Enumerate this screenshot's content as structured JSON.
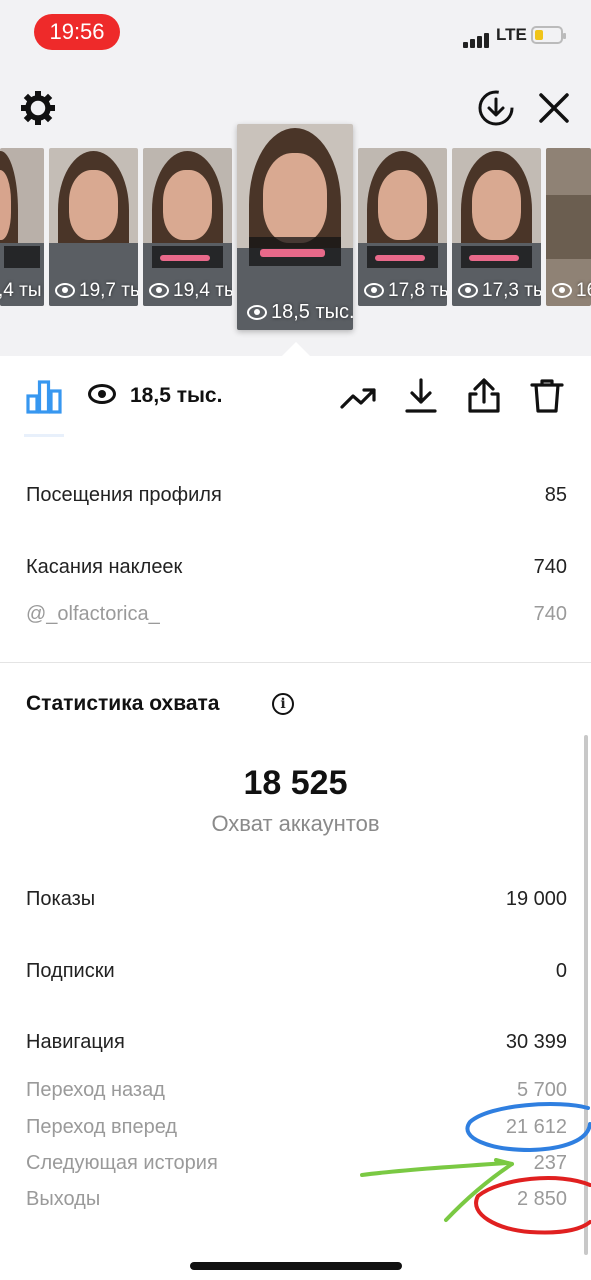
{
  "status_bar": {
    "time": "19:56",
    "network": "LTE",
    "time_pill_color": "#ee2a2a",
    "battery_color": "#f0c419"
  },
  "header_icons": [
    "gear-icon",
    "download-circle-icon",
    "close-icon"
  ],
  "thumbnails": [
    {
      "views": ",4 ты"
    },
    {
      "views": "19,7 ты"
    },
    {
      "views": "19,4 ты"
    },
    {
      "views": "18,5 тыс.",
      "selected": true
    },
    {
      "views": "17,8 ты"
    },
    {
      "views": "17,3 ты"
    },
    {
      "views": "16"
    }
  ],
  "toolbar": {
    "views": "18,5 тыс.",
    "icons": [
      "bar-chart-icon",
      "eye-icon",
      "trending-icon",
      "download-icon",
      "share-icon",
      "trash-icon"
    ],
    "accent": "#3797f0"
  },
  "interactions": {
    "profile_visits": {
      "label": "Посещения профиля",
      "value": "85"
    },
    "sticker_taps": {
      "label": "Касания наклеек",
      "value": "740"
    },
    "sticker_mention": {
      "label": "@_olfactorica_",
      "value": "740"
    }
  },
  "reach": {
    "title": "Статистика охвата",
    "accounts_reached": "18 525",
    "accounts_reached_label": "Охват аккаунтов",
    "impressions": {
      "label": "Показы",
      "value": "19 000"
    },
    "follows": {
      "label": "Подписки",
      "value": "0"
    },
    "navigation": {
      "label": "Навигация",
      "value": "30 399"
    },
    "back": {
      "label": "Переход назад",
      "value": "5 700"
    },
    "forward": {
      "label": "Переход вперед",
      "value": "21 612"
    },
    "next_story": {
      "label": "Следующая история",
      "value": "237"
    },
    "exits": {
      "label": "Выходы",
      "value": "2 850"
    }
  },
  "annotations": {
    "blue": "#2f7fe0",
    "green": "#7ac943",
    "red": "#e02020"
  }
}
